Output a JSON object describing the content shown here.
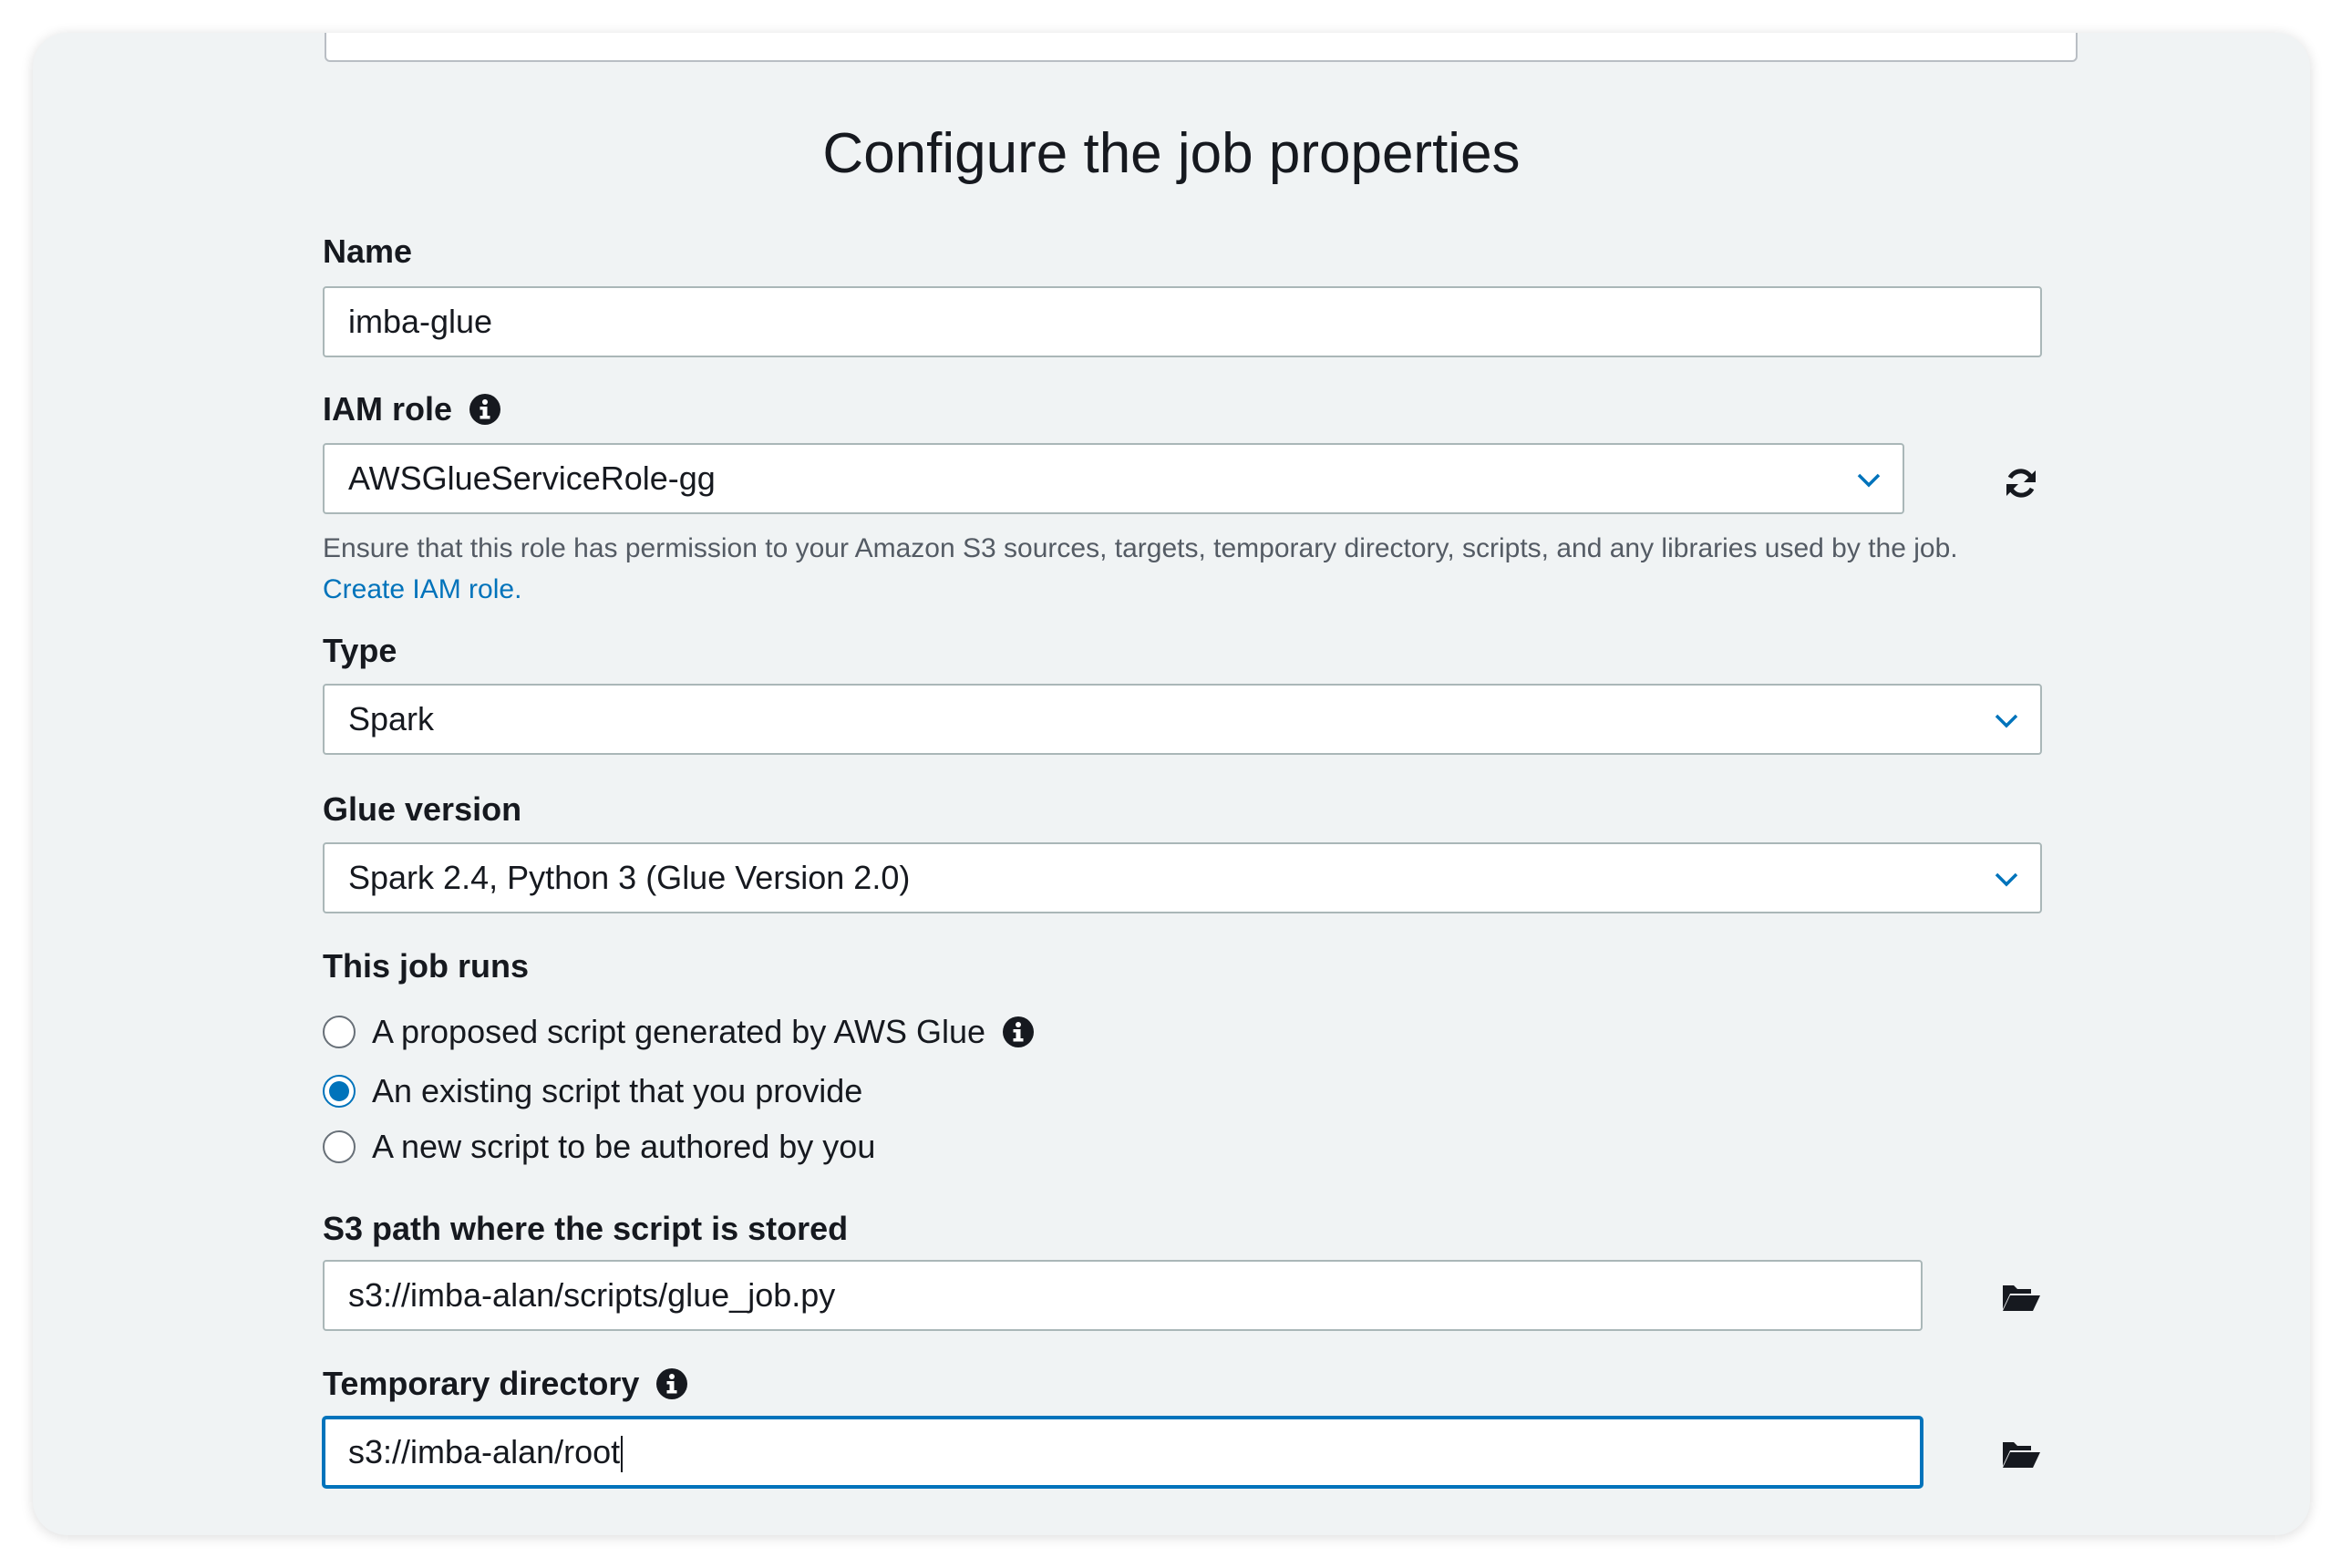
{
  "title": "Configure the job properties",
  "name": {
    "label": "Name",
    "value": "imba-glue"
  },
  "iam_role": {
    "label": "IAM role",
    "value": "AWSGlueServiceRole-gg",
    "help": "Ensure that this role has permission to your Amazon S3 sources, targets, temporary directory, scripts, and any libraries used by the job.",
    "create_link": "Create IAM role."
  },
  "type": {
    "label": "Type",
    "value": "Spark"
  },
  "glue_version": {
    "label": "Glue version",
    "value": "Spark 2.4, Python 3 (Glue Version 2.0)"
  },
  "job_runs": {
    "label": "This job runs",
    "options": [
      {
        "label": "A proposed script generated by AWS Glue",
        "checked": false
      },
      {
        "label": "An existing script that you provide",
        "checked": true
      },
      {
        "label": "A new script to be authored by you",
        "checked": false
      }
    ]
  },
  "s3_path": {
    "label": "S3 path where the script is stored",
    "value": "s3://imba-alan/scripts/glue_job.py"
  },
  "temp_dir": {
    "label": "Temporary directory",
    "value": "s3://imba-alan/root"
  },
  "icons": {
    "info": "info-icon",
    "refresh": "refresh-icon",
    "folder": "folder-open-icon",
    "chevron": "chevron-down-icon"
  },
  "colors": {
    "accent": "#0073bb",
    "background": "#f0f3f4",
    "border": "#aab7b8"
  }
}
